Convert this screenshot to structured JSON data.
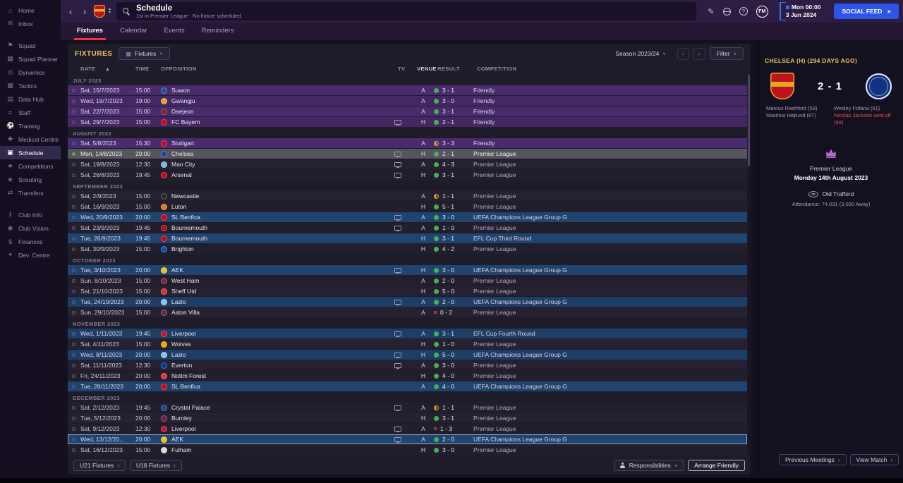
{
  "app": {
    "social_feed": "SOCIAL FEED",
    "date_line1": "Mon 00:00",
    "date_line2": "3 Jun 2024",
    "fm_badge": "FM"
  },
  "header": {
    "title": "Schedule",
    "subtitle": "1st in Premier League - No fixture scheduled."
  },
  "icons": {
    "back": "‹",
    "forward": "›",
    "chevron_down": "∨",
    "sort_asc": "▲",
    "up_small": "▴",
    "down_small": "▾",
    "double_arrow": "»",
    "item_arrow": "›",
    "help": "?",
    "edit": "✎",
    "view": "▦"
  },
  "colors": {
    "accent_red": "#f5333f",
    "win_green": "#42b355",
    "draw_amber": "#d9a521",
    "loss_red": "#dd4f4f",
    "social_blue": "#2d54e8",
    "gold": "#e9c25f",
    "friendly_row": "#4a2c6e",
    "europe_row": "#1f4470"
  },
  "sidebar": {
    "groups": [
      [
        {
          "label": "Home",
          "icon": "⌂"
        },
        {
          "label": "Inbox",
          "icon": "✉"
        }
      ],
      [
        {
          "label": "Squad",
          "icon": "⚑"
        },
        {
          "label": "Squad Planner",
          "icon": "▦"
        },
        {
          "label": "Dynamics",
          "icon": "◎"
        },
        {
          "label": "Tactics",
          "icon": "▩"
        },
        {
          "label": "Data Hub",
          "icon": "▤"
        },
        {
          "label": "Staff",
          "icon": "≡"
        },
        {
          "label": "Training",
          "icon": "⚽"
        },
        {
          "label": "Medical Centre",
          "icon": "✚"
        },
        {
          "label": "Schedule",
          "icon": "▣",
          "active": true
        },
        {
          "label": "Competitions",
          "icon": "★"
        },
        {
          "label": "Scouting",
          "icon": "◈"
        },
        {
          "label": "Transfers",
          "icon": "⇄"
        }
      ],
      [
        {
          "label": "Club Info",
          "icon": "ℹ"
        },
        {
          "label": "Club Vision",
          "icon": "◉"
        },
        {
          "label": "Finances",
          "icon": "$"
        },
        {
          "label": "Dev. Centre",
          "icon": "✦"
        }
      ]
    ]
  },
  "tabs": [
    {
      "label": "Fixtures",
      "active": true
    },
    {
      "label": "Calendar",
      "active": false
    },
    {
      "label": "Events",
      "active": false
    },
    {
      "label": "Reminders",
      "active": false
    }
  ],
  "toolbar": {
    "section_title": "FIXTURES",
    "view_dropdown": "Fixtures",
    "season_dropdown": "Season 2023/24",
    "filter_dropdown": "Filter"
  },
  "table": {
    "headers": [
      "DATE",
      "TIME",
      "OPPOSITION",
      "TV",
      "VENUE",
      "RESULT",
      "COMPETITION"
    ]
  },
  "fixtures": {
    "groups": [
      {
        "month": "JULY 2023",
        "rows": [
          {
            "date": "Sat, 15/7/2023",
            "time": "15:00",
            "opp": "Suwon",
            "crest": "#1d4f9e",
            "tv": false,
            "venue": "A",
            "result": "3 - 1",
            "outcome": "win",
            "comp": "Friendly",
            "type": "friendly"
          },
          {
            "date": "Wed, 19/7/2023",
            "time": "19:00",
            "opp": "Gwangju",
            "crest": "#e8a020",
            "tv": false,
            "venue": "A",
            "result": "3 - 0",
            "outcome": "win",
            "comp": "Friendly",
            "type": "friendly"
          },
          {
            "date": "Sat, 22/7/2023",
            "time": "15:00",
            "opp": "Daejeon",
            "crest": "#7a1f3d",
            "tv": false,
            "venue": "A",
            "result": "3 - 1",
            "outcome": "win",
            "comp": "Friendly",
            "type": "friendly"
          },
          {
            "date": "Sat, 29/7/2023",
            "time": "15:00",
            "opp": "FC Bayern",
            "crest": "#d0021b",
            "tv": true,
            "venue": "H",
            "result": "2 - 1",
            "outcome": "win",
            "comp": "Friendly",
            "type": "friendly"
          }
        ]
      },
      {
        "month": "AUGUST 2023",
        "rows": [
          {
            "date": "Sat, 5/8/2023",
            "time": "15:30",
            "opp": "Stuttgart",
            "crest": "#d0021b",
            "tv": false,
            "venue": "A",
            "result": "3 - 3",
            "outcome": "draw",
            "comp": "Friendly",
            "type": "friendly"
          },
          {
            "date": "Mon, 14/8/2023",
            "time": "20:00",
            "opp": "Chelsea",
            "crest": "#1c44a0",
            "tv": true,
            "venue": "H",
            "result": "2 - 1",
            "outcome": "win",
            "comp": "Premier League",
            "type": "league",
            "selected": true
          },
          {
            "date": "Sat, 19/8/2023",
            "time": "12:30",
            "opp": "Man City",
            "crest": "#7ab6e0",
            "tv": true,
            "venue": "A",
            "result": "4 - 3",
            "outcome": "win",
            "comp": "Premier League",
            "type": "league"
          },
          {
            "date": "Sat, 26/8/2023",
            "time": "19:45",
            "opp": "Arsenal",
            "crest": "#d0021b",
            "tv": true,
            "venue": "H",
            "result": "3 - 1",
            "outcome": "win",
            "comp": "Premier League",
            "type": "league"
          }
        ]
      },
      {
        "month": "SEPTEMBER 2023",
        "rows": [
          {
            "date": "Sat, 2/9/2023",
            "time": "15:00",
            "opp": "Newcastle",
            "crest": "#26262b",
            "tv": false,
            "venue": "A",
            "result": "1 - 1",
            "outcome": "draw",
            "comp": "Premier League",
            "type": "league"
          },
          {
            "date": "Sat, 16/9/2023",
            "time": "15:00",
            "opp": "Luton",
            "crest": "#e87722",
            "tv": false,
            "venue": "H",
            "result": "5 - 1",
            "outcome": "win",
            "comp": "Premier League",
            "type": "league"
          },
          {
            "date": "Wed, 20/9/2023",
            "time": "20:00",
            "opp": "SL Benfica",
            "crest": "#d0021b",
            "tv": true,
            "venue": "A",
            "result": "3 - 0",
            "outcome": "win",
            "comp": "UEFA Champions League Group G",
            "type": "europe"
          },
          {
            "date": "Sat, 23/9/2023",
            "time": "19:45",
            "opp": "Bournemouth",
            "crest": "#b50e12",
            "tv": true,
            "venue": "A",
            "result": "1 - 0",
            "outcome": "win",
            "comp": "Premier League",
            "type": "league"
          },
          {
            "date": "Tue, 26/9/2023",
            "time": "19:45",
            "opp": "Bournemouth",
            "crest": "#b50e12",
            "tv": false,
            "venue": "H",
            "result": "3 - 1",
            "outcome": "win",
            "comp": "EFL Cup Third Round",
            "type": "europe"
          },
          {
            "date": "Sat, 30/9/2023",
            "time": "15:00",
            "opp": "Brighton",
            "crest": "#0057b8",
            "tv": false,
            "venue": "H",
            "result": "4 - 2",
            "outcome": "win",
            "comp": "Premier League",
            "type": "league"
          }
        ]
      },
      {
        "month": "OCTOBER 2023",
        "rows": [
          {
            "date": "Tue, 3/10/2023",
            "time": "20:00",
            "opp": "AEK",
            "crest": "#f0c018",
            "tv": true,
            "venue": "H",
            "result": "3 - 0",
            "outcome": "win",
            "comp": "UEFA Champions League Group G",
            "type": "europe"
          },
          {
            "date": "Sun, 8/10/2023",
            "time": "15:00",
            "opp": "West Ham",
            "crest": "#7a263a",
            "tv": false,
            "venue": "A",
            "result": "2 - 0",
            "outcome": "win",
            "comp": "Premier League",
            "type": "league"
          },
          {
            "date": "Sat, 21/10/2023",
            "time": "15:00",
            "opp": "Sheff Utd",
            "crest": "#e52b2b",
            "tv": false,
            "venue": "H",
            "result": "5 - 0",
            "outcome": "win",
            "comp": "Premier League",
            "type": "league"
          },
          {
            "date": "Tue, 24/10/2023",
            "time": "20:00",
            "opp": "Lazio",
            "crest": "#87c5e8",
            "tv": true,
            "venue": "A",
            "result": "2 - 0",
            "outcome": "win",
            "comp": "UEFA Champions League Group G",
            "type": "europe"
          },
          {
            "date": "Sun, 29/10/2023",
            "time": "15:00",
            "opp": "Aston Villa",
            "crest": "#67273d",
            "tv": false,
            "venue": "A",
            "result": "0 - 2",
            "outcome": "loss",
            "comp": "Premier League",
            "type": "league"
          }
        ]
      },
      {
        "month": "NOVEMBER 2023",
        "rows": [
          {
            "date": "Wed, 1/11/2023",
            "time": "19:45",
            "opp": "Liverpool",
            "crest": "#c8102e",
            "tv": true,
            "venue": "A",
            "result": "3 - 1",
            "outcome": "win",
            "comp": "EFL Cup Fourth Round",
            "type": "europe"
          },
          {
            "date": "Sat, 4/11/2023",
            "time": "15:00",
            "opp": "Wolves",
            "crest": "#f0a800",
            "tv": false,
            "venue": "H",
            "result": "1 - 0",
            "outcome": "win",
            "comp": "Premier League",
            "type": "league"
          },
          {
            "date": "Wed, 8/11/2023",
            "time": "20:00",
            "opp": "Lazio",
            "crest": "#87c5e8",
            "tv": true,
            "venue": "H",
            "result": "5 - 0",
            "outcome": "win",
            "comp": "UEFA Champions League Group G",
            "type": "europe"
          },
          {
            "date": "Sat, 11/11/2023",
            "time": "12:30",
            "opp": "Everton",
            "crest": "#00369c",
            "tv": true,
            "venue": "A",
            "result": "3 - 0",
            "outcome": "win",
            "comp": "Premier League",
            "type": "league"
          },
          {
            "date": "Fri, 24/11/2023",
            "time": "20:00",
            "opp": "Nottm Forest",
            "crest": "#e53232",
            "tv": false,
            "venue": "H",
            "result": "4 - 0",
            "outcome": "win",
            "comp": "Premier League",
            "type": "league"
          },
          {
            "date": "Tue, 28/11/2023",
            "time": "20:00",
            "opp": "SL Benfica",
            "crest": "#d0021b",
            "tv": false,
            "venue": "A",
            "result": "4 - 0",
            "outcome": "win",
            "comp": "UEFA Champions League Group G",
            "type": "europe"
          }
        ]
      },
      {
        "month": "DECEMBER 2023",
        "rows": [
          {
            "date": "Sat, 2/12/2023",
            "time": "19:45",
            "opp": "Crystal Palace",
            "crest": "#1b458f",
            "tv": true,
            "venue": "A",
            "result": "1 - 1",
            "outcome": "draw",
            "comp": "Premier League",
            "type": "league"
          },
          {
            "date": "Tue, 5/12/2023",
            "time": "20:00",
            "opp": "Burnley",
            "crest": "#6c1d45",
            "tv": false,
            "venue": "H",
            "result": "3 - 1",
            "outcome": "win",
            "comp": "Premier League",
            "type": "league"
          },
          {
            "date": "Sat, 9/12/2023",
            "time": "12:30",
            "opp": "Liverpool",
            "crest": "#c8102e",
            "tv": true,
            "venue": "A",
            "result": "1 - 3",
            "outcome": "loss",
            "comp": "Premier League",
            "type": "league"
          },
          {
            "date": "Wed, 13/12/20...",
            "time": "20:00",
            "opp": "AEK",
            "crest": "#f0c018",
            "tv": true,
            "venue": "A",
            "result": "2 - 0",
            "outcome": "win",
            "comp": "UEFA Champions League Group G",
            "type": "europe",
            "focused": true
          },
          {
            "date": "Sat, 16/12/2023",
            "time": "15:00",
            "opp": "Fulham",
            "crest": "#d8d8d8",
            "tv": false,
            "venue": "H",
            "result": "3 - 0",
            "outcome": "win",
            "comp": "Premier League",
            "type": "league"
          }
        ]
      }
    ]
  },
  "footer": {
    "u21": "U21 Fixtures",
    "u18": "U18 Fixtures",
    "responsibilities": "Responsibilities",
    "arrange_friendly": "Arrange Friendly"
  },
  "match_panel": {
    "title": "CHELSEA (H) (294 DAYS AGO)",
    "score": "2 - 1",
    "home_scorers": [
      "Marcus Rashford (59)",
      "Rasmus Højlund (87)"
    ],
    "away_scorers": [
      "Wesley Fofana (61)"
    ],
    "away_cards": [
      "Nicolas Jackson sent off (69)"
    ],
    "competition": "Premier League",
    "match_date": "Monday 14th August 2023",
    "stadium": "Old Trafford",
    "attendance": "Attendance: 74.031 (3.000 Away)",
    "previous_meetings": "Previous Meetings",
    "view_match": "View Match"
  }
}
